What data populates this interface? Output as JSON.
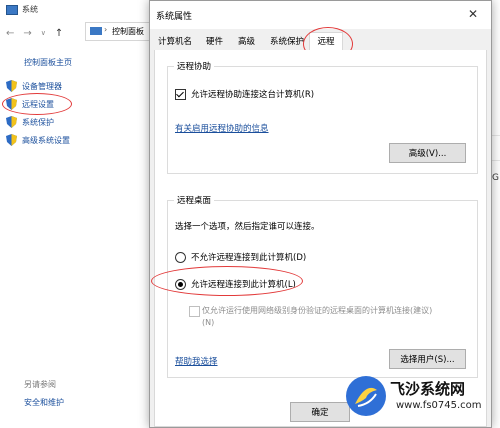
{
  "background_window": {
    "title": "系统",
    "address_text": "控制面板",
    "control_panel_home": "控制面板主页",
    "side_items": [
      "设备管理器",
      "远程设置",
      "系统保护",
      "高级系统设置"
    ],
    "see_also": "另请参阅",
    "security_maintenance": "安全和维护",
    "right_fragment": "G"
  },
  "dialog": {
    "title": "系统属性",
    "close_glyph": "✕",
    "tabs": [
      "计算机名",
      "硬件",
      "高级",
      "系统保护",
      "远程"
    ],
    "active_tab": "远程",
    "remote_assistance": {
      "group_title": "远程协助",
      "allow_checkbox_label": "允许远程协助连接这台计算机(R)",
      "allow_checked": true,
      "info_link": "有关启用远程协助的信息",
      "advanced_button": "高级(V)..."
    },
    "remote_desktop": {
      "group_title": "远程桌面",
      "instruction": "选择一个选项，然后指定谁可以连接。",
      "option_disallow": "不允许远程连接到此计算机(D)",
      "option_allow": "允许远程连接到此计算机(L)",
      "selected": "allow",
      "nla_label_line1": "仅允许运行使用网络级别身份验证的远程桌面的计算机连接(建议)",
      "nla_label_line2": "(N)",
      "help_link": "帮助我选择",
      "select_users_button": "选择用户(S)..."
    },
    "ok_button": "确定"
  },
  "watermark": {
    "name": "飞沙系统网",
    "url": "www.fs0745.com"
  },
  "colors": {
    "link": "#1b4f9c",
    "annotation": "#e23a3a",
    "dialog_bg": "#f0f0f0"
  }
}
